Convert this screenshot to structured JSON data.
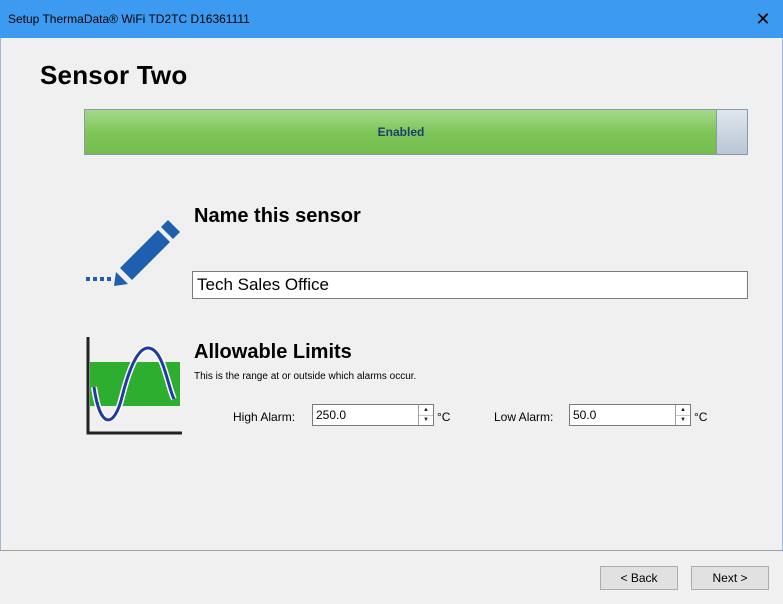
{
  "window": {
    "title": "Setup ThermaData® WiFi TD2TC D16361111",
    "close_glyph": "✕"
  },
  "page": {
    "heading": "Sensor Two"
  },
  "toggle": {
    "label": "Enabled",
    "state": "enabled"
  },
  "name_section": {
    "title": "Name this sensor",
    "input_value": "Tech Sales Office",
    "icon": "pencil-icon"
  },
  "limits": {
    "title": "Allowable Limits",
    "description": "This is the range at or outside which alarms occur.",
    "icon": "sine-chart-icon",
    "high_label": "High Alarm:",
    "high_value": "250.0",
    "high_unit": "°C",
    "low_label": "Low Alarm:",
    "low_value": "50.0",
    "low_unit": "°C"
  },
  "footer": {
    "back_label": "< Back",
    "next_label": "Next >"
  },
  "colors": {
    "titlebar": "#3c9bf0",
    "toggle_green": "#7fc65a",
    "icon_blue": "#1f5fae",
    "chart_green": "#2eae2e"
  }
}
